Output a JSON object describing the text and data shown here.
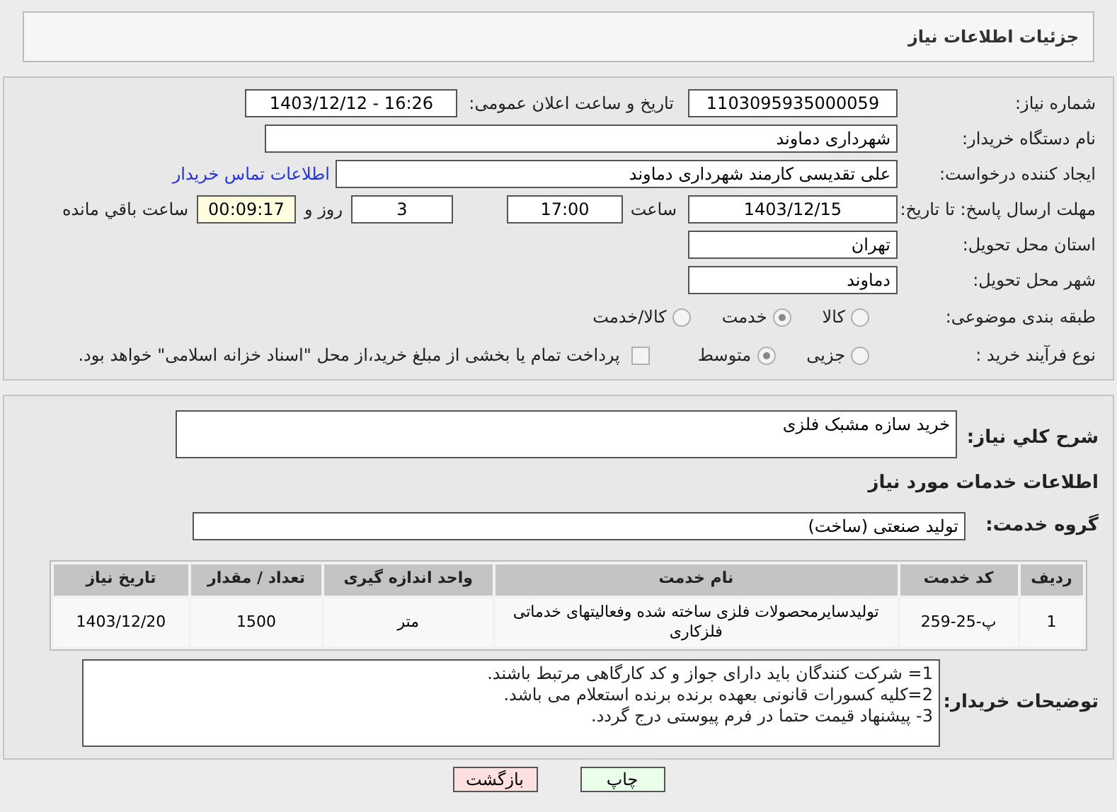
{
  "header": {
    "title": "جزئیات اطلاعات نیاز"
  },
  "need_number": {
    "label": "شماره نیاز:",
    "value": "1103095935000059"
  },
  "announce": {
    "label": "تاریخ و ساعت اعلان عمومی:",
    "value": "1403/12/12 - 16:26"
  },
  "buyer_org": {
    "label": "نام دستگاه خریدار:",
    "value": "شهرداری دماوند"
  },
  "requester": {
    "label": "ایجاد کننده درخواست:",
    "value": "علی تقدیسی کارمند شهرداری دماوند",
    "link": "اطلاعات تماس خریدار"
  },
  "deadline": {
    "label": "مهلت ارسال پاسخ: تا تاریخ:",
    "date": "1403/12/15",
    "time_label": "ساعت",
    "time": "17:00",
    "days": "3",
    "days_label": "روز و",
    "remaining": "00:09:17",
    "remaining_label": "ساعت باقي مانده"
  },
  "province": {
    "label": "استان محل تحویل:",
    "value": "تهران"
  },
  "city": {
    "label": "شهر محل تحویل:",
    "value": "دماوند"
  },
  "category": {
    "label": "طبقه بندی موضوعی:",
    "options": [
      {
        "label": "کالا",
        "selected": false
      },
      {
        "label": "خدمت",
        "selected": true
      },
      {
        "label": "کالا/خدمت",
        "selected": false
      }
    ]
  },
  "process": {
    "label": "نوع فرآیند خرید :",
    "options": [
      {
        "label": "جزیی",
        "selected": false
      },
      {
        "label": "متوسط",
        "selected": true
      }
    ],
    "payment": {
      "checked": false,
      "text": "پرداخت تمام یا بخشی از مبلغ خرید،از محل \"اسناد خزانه اسلامی\" خواهد بود."
    }
  },
  "description": {
    "label": "شرح کلي نیاز:",
    "value": "خرید سازه مشبک فلزی"
  },
  "services_title": "اطلاعات خدمات مورد نیاز",
  "service_group": {
    "label": "گروه خدمت:",
    "value": "تولید صنعتی (ساخت)"
  },
  "table": {
    "columns": [
      "ردیف",
      "کد خدمت",
      "نام خدمت",
      "واحد اندازه گیری",
      "تعداد / مقدار",
      "تاریخ نیاز"
    ],
    "rows": [
      [
        "1",
        "پ-25-259",
        "تولیدسایرمحصولات فلزی ساخته شده وفعالیتهای خدماتی فلزکاری",
        "متر",
        "1500",
        "1403/12/20"
      ]
    ]
  },
  "buyer_notes": {
    "label": "توضیحات خریدار:",
    "lines": [
      "1= شرکت کنندگان باید دارای جواز و کد کارگاهی مرتبط باشند.",
      "2=کلیه کسورات قانونی بعهده برنده برنده استعلام می باشد.",
      "3- پیشنهاد قیمت حتما در فرم پیوستی درج گردد."
    ]
  },
  "buttons": [
    {
      "label": "چاپ",
      "kind": "print"
    },
    {
      "label": "بازگشت",
      "kind": "back"
    }
  ]
}
